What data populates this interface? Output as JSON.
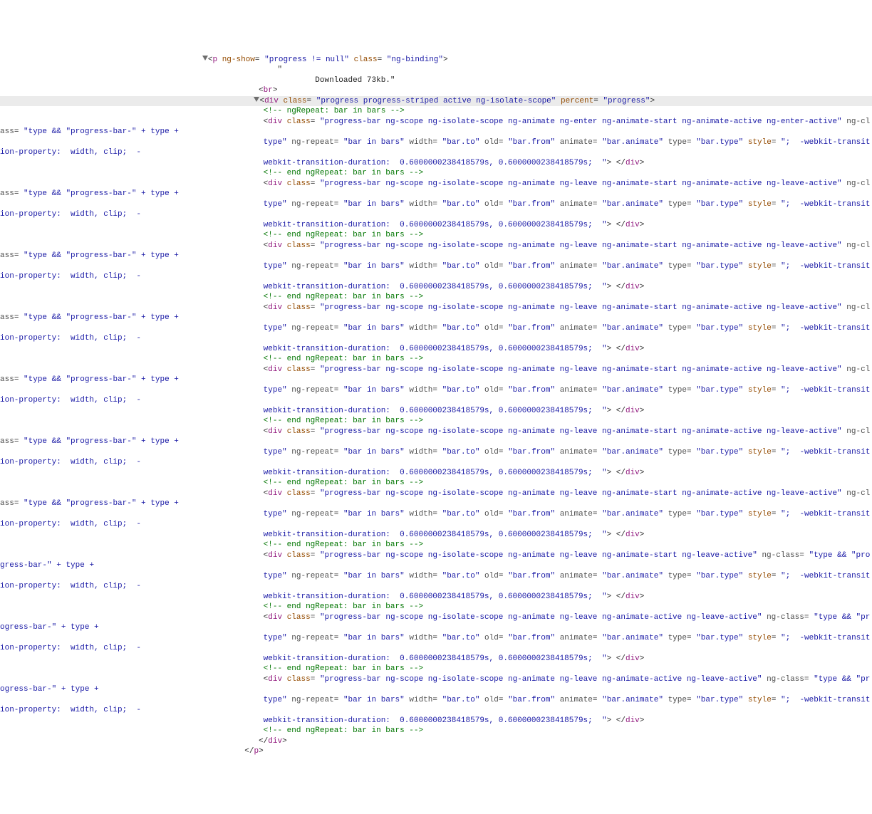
{
  "line_p_open": {
    "tag": "p",
    "a1": "ng-show",
    "v1": "\"progress != null\"",
    "a2": "class",
    "v2": "\"ng-binding\""
  },
  "text_quote1": "        \"",
  "text_dl": "                Downloaded 73kb.\"",
  "br_tag": "br",
  "line_div_open": {
    "tag": "div",
    "a1": "class",
    "v1": "\"progress progress-striped active ng-isolate-scope\"",
    "a2": "percent",
    "v2": "\"progress\""
  },
  "cmt_repeat_start": "<!-- ngRepeat: bar in bars -->",
  "cmt_repeat_end": "<!-- end ngRepeat: bar in bars -->",
  "block_A": {
    "class_val": "\"progress-bar ng-scope ng-isolate-scope ng-animate ng-enter ng-animate-start ng-animate-active ng-enter-active\"",
    "ngclass_val": "\"type && \"progress-bar-\" + type\""
  },
  "block_B": {
    "class_val": "\"progress-bar ng-scope ng-isolate-scope ng-animate ng-leave ng-animate-start ng-animate-active ng-leave-active\"",
    "ngclass_val": "\"type && \"progress-bar-\" + type\""
  },
  "block_C": {
    "class_val": "\"progress-bar ng-scope ng-isolate-scope ng-animate ng-leave ng-animate-start ng-leave-active\"",
    "ngclass_val": "\"type && \"progress-bar-\" + type\""
  },
  "block_D": {
    "class_val": "\"progress-bar ng-scope ng-isolate-scope ng-animate ng-leave ng-animate-active ng-leave-active\"",
    "ngclass_val": "\"type && \"progress-bar-\" + type\""
  },
  "common": {
    "div_tag": "div",
    "class_attr": "class",
    "ngclass_attr": "ng-class",
    "ngrepeat_attr": "ng-repeat",
    "ngrepeat_val": "\"bar in bars\"",
    "width_attr": "width",
    "width_val": "\"bar.to\"",
    "old_attr": "old",
    "old_val": "\"bar.from\"",
    "animate_attr": "animate",
    "animate_val": "\"bar.animate\"",
    "type_attr": "type",
    "type_val": "\"bar.type\"",
    "style_attr": "style",
    "style_val": "\";  -webkit-transition-property:  width, clip;  -webkit-transition-duration:  0.6000000238418579s, 0.6000000238418579s;  \"",
    "closing": "</div>"
  },
  "close_div_tag": "div",
  "close_p_tag": "p",
  "indents": {
    "i0": "                                            ",
    "i1": "       ",
    "i2": "        ",
    "i3": "           ",
    "i4": "            "
  }
}
